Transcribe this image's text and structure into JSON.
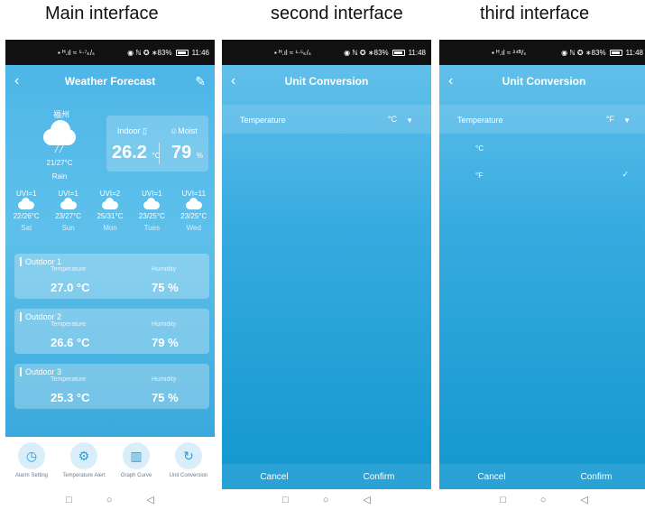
{
  "captions": [
    "Main interface",
    "second interface",
    "third interface"
  ],
  "status": {
    "p1": {
      "left": "▪ ᴴ.ıl ≈ ⁵·⁷ₖ/ₛ",
      "right": "◉ ℕ ✪ ∗83%",
      "time": "11:46"
    },
    "p2": {
      "left": "▪ ᴴ.ıl ≈ ¹·⁵ₖ/ₛ",
      "right": "◉ ℕ ✪ ∗83%",
      "time": "11:48"
    },
    "p3": {
      "left": "▪ ᴴ.ıl ≈ ²⁴ᴮ/ₛ",
      "right": "◉ ℕ ✪ ∗83%",
      "time": "11:48"
    }
  },
  "main": {
    "title": "Weather Forecast",
    "city": "福州",
    "temp_range": "21/27°C",
    "condition": "Rain",
    "indoor": {
      "label": "Indoor",
      "moist_label": "Moist",
      "temp": "26.2",
      "temp_unit": "°C",
      "humidity": "79",
      "hum_unit": "%"
    },
    "forecast": [
      {
        "uvi": "UVI=1",
        "range": "22/26°C",
        "day": "Sat"
      },
      {
        "uvi": "UVI=1",
        "range": "23/27°C",
        "day": "Sun"
      },
      {
        "uvi": "UVI=2",
        "range": "25/31°C",
        "day": "Mon"
      },
      {
        "uvi": "UVI=1",
        "range": "23/25°C",
        "day": "Tues"
      },
      {
        "uvi": "UVI=11",
        "range": "23/25°C",
        "day": "Wed"
      }
    ],
    "outdoor": [
      {
        "name": "Outdoor 1",
        "temp_label": "Temperature",
        "hum_label": "Humidity",
        "temp": "27.0 °C",
        "hum": "75 %"
      },
      {
        "name": "Outdoor 2",
        "temp_label": "Temperature",
        "hum_label": "Humidity",
        "temp": "26.6 °C",
        "hum": "79 %"
      },
      {
        "name": "Outdoor 3",
        "temp_label": "Temperature",
        "hum_label": "Humidity",
        "temp": "25.3 °C",
        "hum": "75 %"
      }
    ],
    "nav": [
      {
        "label": "Alarm Setting",
        "icon": "timer-icon",
        "glyph": "◷"
      },
      {
        "label": "Temperature Alert",
        "icon": "gear-icon",
        "glyph": "⚙"
      },
      {
        "label": "Graph Curve",
        "icon": "chart-icon",
        "glyph": "▥"
      },
      {
        "label": "Unit Conversion",
        "icon": "refresh-icon",
        "glyph": "↻"
      }
    ]
  },
  "conv": {
    "title": "Unit Conversion",
    "row_label": "Temperature",
    "unit_c": "°C",
    "unit_f": "°F",
    "option_c": "°C",
    "option_f": "°F",
    "cancel": "Cancel",
    "confirm": "Confirm"
  },
  "sysnav": {
    "square": "□",
    "circle": "○",
    "back": "◁"
  }
}
